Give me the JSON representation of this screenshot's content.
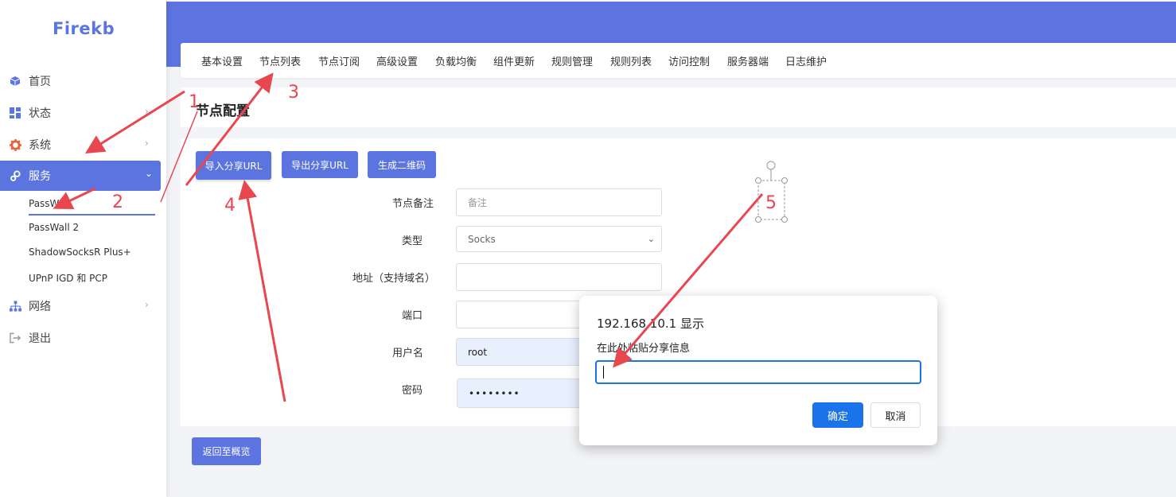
{
  "sidebar": {
    "logo": "Firekb",
    "items": [
      {
        "label": "首页",
        "icon": "cube-icon"
      },
      {
        "label": "状态",
        "icon": "dashboard-icon"
      },
      {
        "label": "系统",
        "icon": "gear-icon"
      },
      {
        "label": "服务",
        "icon": "cogs-icon"
      },
      {
        "label": "网络",
        "icon": "sitemap-icon"
      },
      {
        "label": "退出",
        "icon": "logout-icon"
      }
    ],
    "sub_items": [
      "PassWall",
      "PassWall 2",
      "ShadowSocksR Plus+",
      "UPnP IGD 和 PCP"
    ]
  },
  "tabs": [
    "基本设置",
    "节点列表",
    "节点订阅",
    "高级设置",
    "负载均衡",
    "组件更新",
    "规则管理",
    "规则列表",
    "访问控制",
    "服务器端",
    "日志维护"
  ],
  "section": {
    "title": "节点配置"
  },
  "actions": {
    "import": "导入分享URL",
    "export": "导出分享URL",
    "qrcode": "生成二维码"
  },
  "form": {
    "remark": {
      "label": "节点备注",
      "placeholder": "备注"
    },
    "type": {
      "label": "类型",
      "value": "Socks"
    },
    "address": {
      "label": "地址（支持域名）",
      "value": ""
    },
    "port": {
      "label": "端口",
      "value": ""
    },
    "username": {
      "label": "用户名",
      "value": "root"
    },
    "password": {
      "label": "密码",
      "value": "••••••••"
    }
  },
  "back_button": "返回至概览",
  "dialog": {
    "title": "192.168.10.1 显示",
    "message": "在此处粘贴分享信息",
    "ok": "确定",
    "cancel": "取消"
  },
  "annotations": [
    "1",
    "2",
    "3",
    "4",
    "5"
  ],
  "colors": {
    "accent": "#5b74e0",
    "header": "#5d73e0",
    "dialog_primary": "#1a73e8",
    "annotation": "#e8474f"
  }
}
